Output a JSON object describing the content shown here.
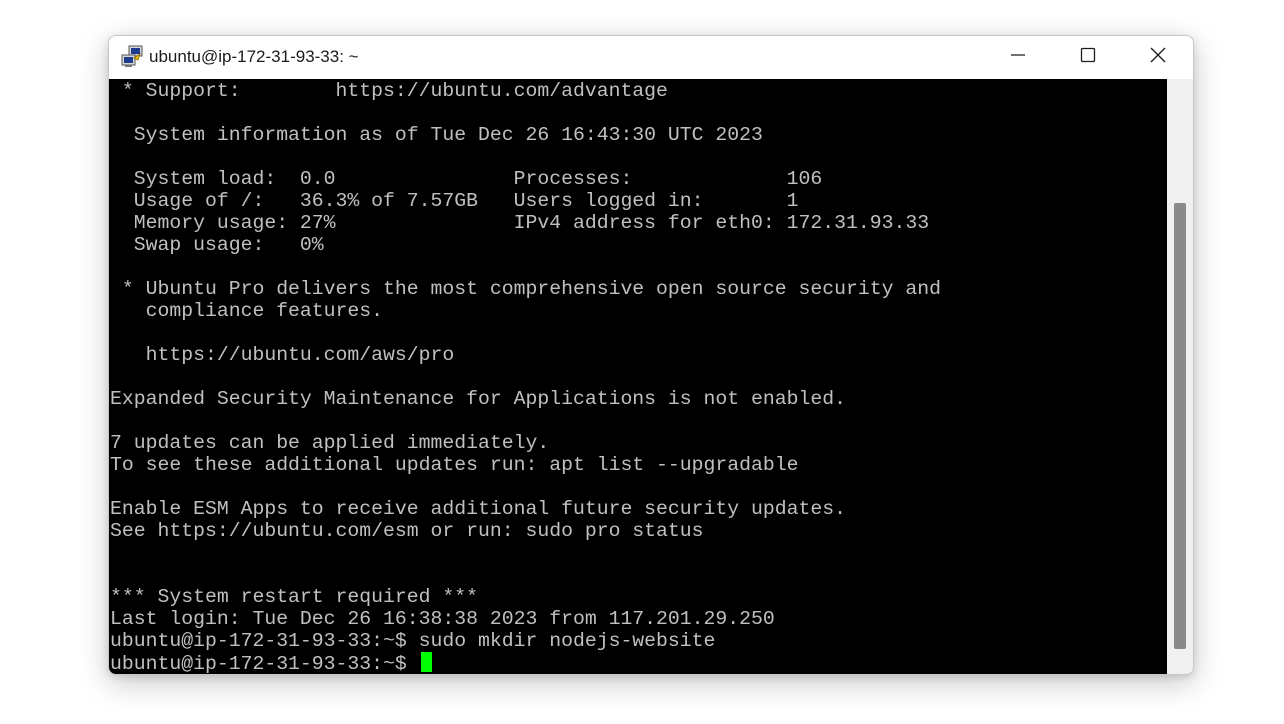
{
  "window": {
    "title": "ubuntu@ip-172-31-93-33: ~",
    "icon": "putty-icon",
    "controls": [
      "minimize-icon",
      "maximize-icon",
      "close-icon"
    ]
  },
  "terminal": {
    "background": "#000000",
    "foreground": "#c0c0c0",
    "cursor_color": "#00ff00",
    "lines": [
      " * Support:        https://ubuntu.com/advantage",
      "",
      "  System information as of Tue Dec 26 16:43:30 UTC 2023",
      "",
      "  System load:  0.0               Processes:             106",
      "  Usage of /:   36.3% of 7.57GB   Users logged in:       1",
      "  Memory usage: 27%               IPv4 address for eth0: 172.31.93.33",
      "  Swap usage:   0%",
      "",
      " * Ubuntu Pro delivers the most comprehensive open source security and",
      "   compliance features.",
      "",
      "   https://ubuntu.com/aws/pro",
      "",
      "Expanded Security Maintenance for Applications is not enabled.",
      "",
      "7 updates can be applied immediately.",
      "To see these additional updates run: apt list --upgradable",
      "",
      "Enable ESM Apps to receive additional future security updates.",
      "See https://ubuntu.com/esm or run: sudo pro status",
      "",
      "",
      "*** System restart required ***",
      "Last login: Tue Dec 26 16:38:38 2023 from 117.201.29.250",
      "ubuntu@ip-172-31-93-33:~$ sudo mkdir nodejs-website"
    ],
    "prompt": "ubuntu@ip-172-31-93-33:~$ "
  }
}
